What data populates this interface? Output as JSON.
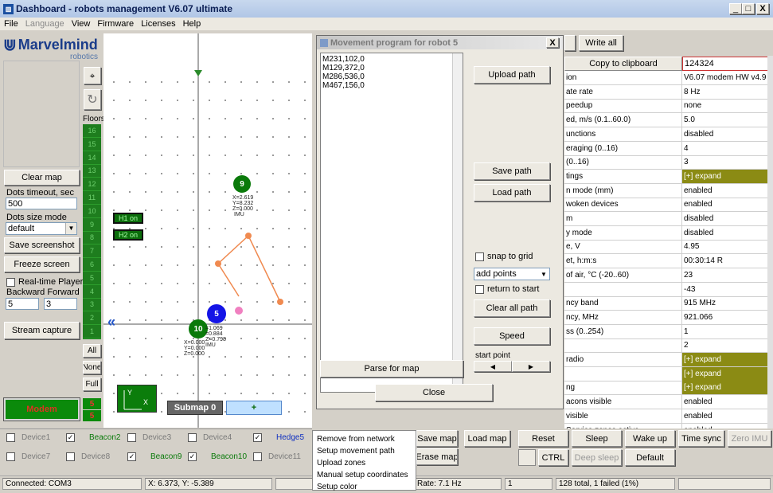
{
  "window": {
    "title": "Dashboard - robots management  V6.07  ultimate",
    "min": "_",
    "max": "□",
    "close": "X"
  },
  "menu": [
    "File",
    "Language",
    "View",
    "Firmware",
    "Licenses",
    "Help"
  ],
  "brand": {
    "name": "Marvelmind",
    "sub": "robotics"
  },
  "left": {
    "clear_map": "Clear map",
    "dots_timeout_label": "Dots timeout, sec",
    "dots_timeout_value": "500",
    "dots_size_label": "Dots size mode",
    "dots_size_value": "default",
    "save_screenshot": "Save screenshot",
    "freeze_screen": "Freeze screen",
    "realtime_player": "Real-time Player",
    "backward_forward": "Backward Forward",
    "back_value": "5",
    "fwd_value": "3",
    "stream_capture": "Stream capture",
    "modem": "Modem",
    "modem_num1": "5",
    "modem_num2": "5"
  },
  "floors": {
    "label": "Floors",
    "items": [
      "16",
      "15",
      "14",
      "13",
      "12",
      "11",
      "10",
      "9",
      "8",
      "7",
      "6",
      "5",
      "4",
      "3",
      "2",
      "1"
    ],
    "all": "All",
    "none": "None",
    "full": "Full"
  },
  "canvas": {
    "h1": "H1 on",
    "h2": "H2 on",
    "submap": "Submap 0",
    "plus": "+",
    "beacon9": {
      "id": "9",
      "coords": "X=2.619\nY=8.232\nZ=0.000\n IMU"
    },
    "beacon10": {
      "id": "10",
      "coords": "X=0.000\nY=0.000\nZ=0.000"
    },
    "beacon5": {
      "id": "5",
      "coords": "=1.069\n=0.884\nZ=0.798\nIMU"
    }
  },
  "dialog": {
    "title": "Movement program for robot 5",
    "close": "X",
    "program_lines": [
      "M231,102,0",
      "M129,372,0",
      "M286,536,0",
      "M467,156,0"
    ],
    "upload_path": "Upload path",
    "save_path": "Save path",
    "load_path": "Load path",
    "snap_to_grid": "snap to grid",
    "mode_value": "add points",
    "return_to_start": "return to start",
    "clear_all_path": "Clear all path",
    "speed": "Speed",
    "start_point": "start point",
    "parse_for_map": "Parse for map",
    "close_btn": "Close"
  },
  "right": {
    "write_all": "Write all",
    "copy_clipboard": "Copy to clipboard",
    "rows": [
      {
        "k": "ion",
        "v": "V6.07 modem HW v4.9"
      },
      {
        "k": "ate rate",
        "v": "8 Hz"
      },
      {
        "k": "peedup",
        "v": "none"
      },
      {
        "k": "ed, m/s (0.1..60.0)",
        "v": "5.0"
      },
      {
        "k": "unctions",
        "v": "disabled"
      },
      {
        "k": "eraging (0..16)",
        "v": "4"
      },
      {
        "k": " (0..16)",
        "v": "3"
      },
      {
        "k": "tings",
        "v": "[+] expand",
        "hl": true
      },
      {
        "k": "n mode (mm)",
        "v": "enabled"
      },
      {
        "k": "woken devices",
        "v": "enabled"
      },
      {
        "k": "m",
        "v": "disabled"
      },
      {
        "k": "y mode",
        "v": "disabled"
      },
      {
        "k": "e, V",
        "v": "4.95"
      },
      {
        "k": "et, h:m:s",
        "v": "00:30:14  R"
      },
      {
        "k": "of air, °C (-20..60)",
        "v": "23"
      },
      {
        "k": "",
        "v": "-43"
      },
      {
        "k": "ncy band",
        "v": "915 MHz"
      },
      {
        "k": "ncy, MHz",
        "v": "921.066"
      },
      {
        "k": "ss (0..254)",
        "v": "1"
      },
      {
        "k": "",
        "v": "2"
      },
      {
        "k": " radio",
        "v": "[+] expand",
        "hl": true
      },
      {
        "k": "",
        "v": "[+] expand",
        "hl": true
      },
      {
        "k": "ng",
        "v": "[+] expand",
        "hl": true
      },
      {
        "k": "acons visible",
        "v": "enabled"
      },
      {
        "k": " visible",
        "v": "enabled"
      },
      {
        "k": "Service zones active",
        "v": "enabled"
      }
    ],
    "header_value": "124324"
  },
  "context_menu": [
    "Remove from network",
    "Setup movement path",
    "Upload zones",
    "Manual setup coordinates",
    "Setup color"
  ],
  "devices_row1": [
    {
      "name": "Device1",
      "checked": false,
      "style": "lbl"
    },
    {
      "name": "Beacon2",
      "checked": true,
      "style": "grn"
    },
    {
      "name": "Device3",
      "checked": false,
      "style": "lbl"
    },
    {
      "name": "Device4",
      "checked": false,
      "style": "lbl"
    },
    {
      "name": "Hedge5",
      "checked": true,
      "style": "blu"
    }
  ],
  "devices_row2": [
    {
      "name": "Device7",
      "checked": false,
      "style": "lbl"
    },
    {
      "name": "Device8",
      "checked": false,
      "style": "lbl"
    },
    {
      "name": "Beacon9",
      "checked": true,
      "style": "grn"
    },
    {
      "name": "Beacon10",
      "checked": true,
      "style": "grn"
    },
    {
      "name": "Device11",
      "checked": false,
      "style": "lbl"
    }
  ],
  "bottom_buttons": {
    "save_map": "Save map",
    "load_map": "Load map",
    "erase_map": "Erase map",
    "reset": "Reset",
    "sleep": "Sleep",
    "wake_up": "Wake up",
    "time_sync": "Time sync",
    "zero_imu": "Zero IMU",
    "ctrl": "CTRL",
    "deep_sleep": "Deep sleep",
    "default": "Default"
  },
  "status": {
    "connected": "Connected: COM3",
    "xy": "X: 6.373, Y: -5.389",
    "rate": "Rate: 7.1 Hz",
    "num": "1",
    "total": "128 total, 1 failed (1%)"
  }
}
